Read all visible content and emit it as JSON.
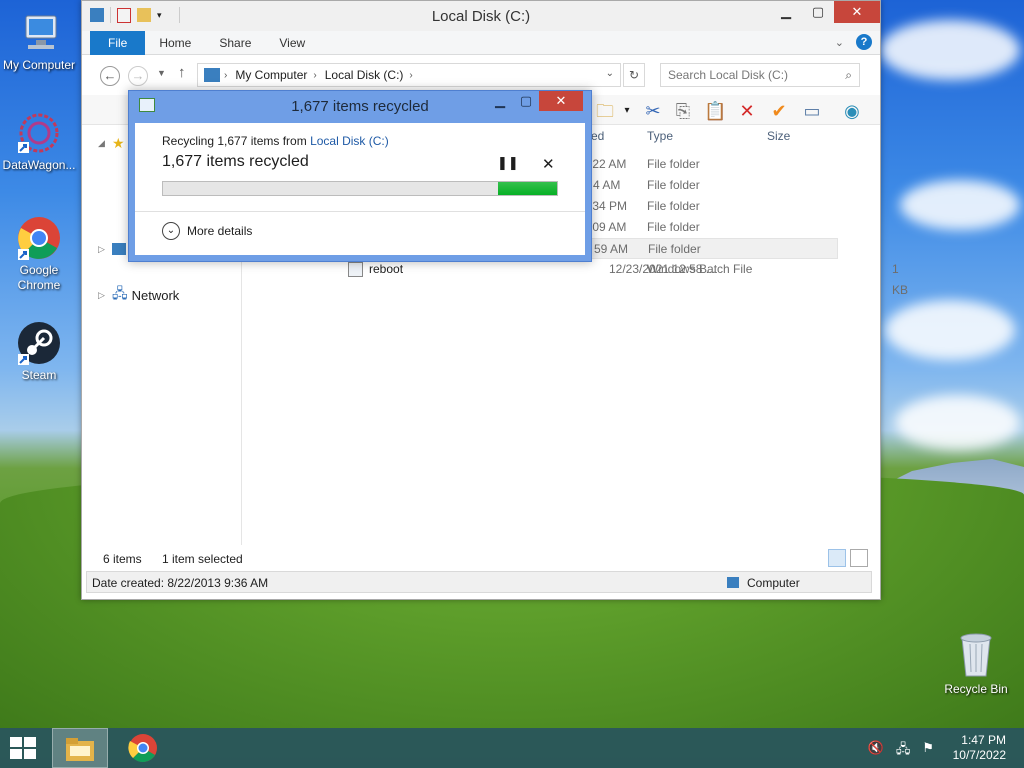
{
  "desktop": {
    "icons": [
      {
        "label": "My Computer"
      },
      {
        "label": "DataWagon..."
      },
      {
        "label": "Google\nChrome"
      },
      {
        "label": "Steam"
      }
    ],
    "recycle_bin": "Recycle Bin"
  },
  "window": {
    "title": "Local Disk (C:)",
    "tabs": {
      "file": "File",
      "home": "Home",
      "share": "Share",
      "view": "View"
    },
    "address": {
      "crumb1": "My Computer",
      "crumb2": "Local Disk (C:)"
    },
    "search_placeholder": "Search Local Disk (C:)",
    "nav": {
      "network": "Network"
    },
    "columns": {
      "date": "ed",
      "type": "Type",
      "size": "Size"
    },
    "files": [
      {
        "date": ":22 AM",
        "type": "File folder",
        "size": ""
      },
      {
        "date": "4 AM",
        "type": "File folder",
        "size": ""
      },
      {
        "date": ":34 PM",
        "type": "File folder",
        "size": ""
      },
      {
        "date": ":09 AM",
        "type": "File folder",
        "size": ""
      },
      {
        "date": "59 AM",
        "type": "File folder",
        "size": ""
      },
      {
        "name": "reboot",
        "date": "12/23/2021 12:58 ...",
        "type": "Windows Batch File",
        "size": "1 KB"
      }
    ],
    "status": {
      "count": "6 items",
      "selected": "1 item selected"
    },
    "details": {
      "date_created": "Date created: 8/22/2013 9:36 AM",
      "location": "Computer"
    }
  },
  "dialog": {
    "title": "1,677 items recycled",
    "line1_prefix": "Recycling 1,677 items from ",
    "line1_link": "Local Disk (C:)",
    "status": "1,677 items recycled",
    "progress_fill_start": 0.85,
    "progress_fill_end": 1.0,
    "more_details": "More details"
  },
  "taskbar": {
    "time": "1:47 PM",
    "date": "10/7/2022"
  },
  "colors": {
    "accent": "#1979ca",
    "progress_green": "#06b025",
    "close_red": "#c7463b"
  }
}
